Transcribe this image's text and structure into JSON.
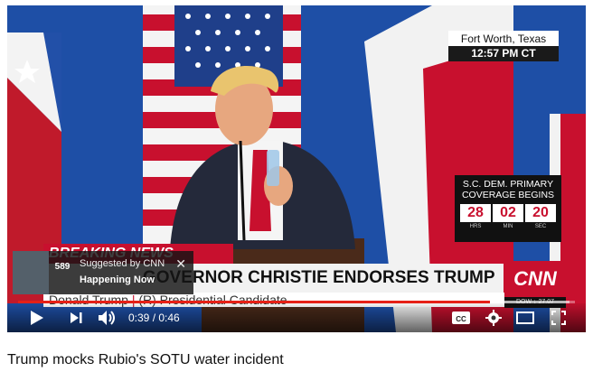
{
  "video": {
    "location": "Fort Worth, Texas",
    "time": "12:57 PM CT",
    "coverage": {
      "title_line1": "S.C. DEM. PRIMARY",
      "title_line2": "COVERAGE BEGINS",
      "hours": "28",
      "minutes": "02",
      "seconds": "20",
      "hours_label": "HRS",
      "minutes_label": "MIN",
      "seconds_label": "SEC"
    },
    "breaking_label": "BREAKING NEWS",
    "headline": "GOVERNOR CHRISTIE ENDORSES TRUMP",
    "name": "Donald Trump",
    "party": "(R) Presidential Candidate",
    "network": "CNN",
    "ticker": "DOW ↓ 27.07"
  },
  "suggestion": {
    "count": "589",
    "by": "Suggested by CNN",
    "label": "Happening Now"
  },
  "player": {
    "current_time": "0:39",
    "duration": "0:46",
    "progress_fraction": 0.848,
    "buffered_fraction": 0.99
  },
  "page": {
    "title": "Trump mocks Rubio's SOTU water incident"
  },
  "colors": {
    "accent": "#e62117",
    "cnn_red": "#c8102e"
  },
  "icons": [
    "play-icon",
    "next-icon",
    "volume-icon",
    "captions-icon",
    "settings-icon",
    "theater-mode-icon",
    "fullscreen-icon",
    "close-icon"
  ]
}
